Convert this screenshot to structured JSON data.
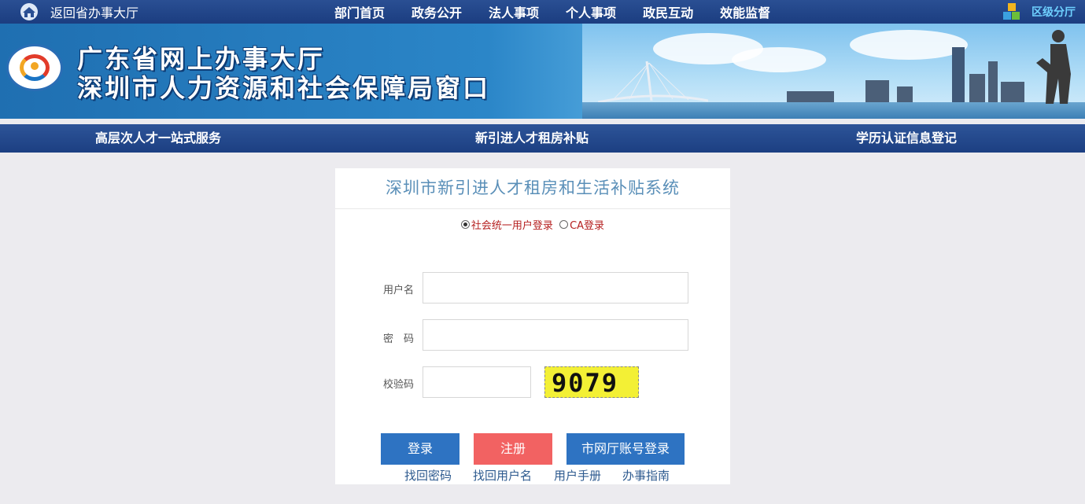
{
  "topbar": {
    "back_label": "返回省办事大厅",
    "nav": [
      "部门首页",
      "政务公开",
      "法人事项",
      "个人事项",
      "政民互动",
      "效能监督"
    ],
    "district_label": "区级分厅"
  },
  "banner": {
    "title_line1": "广东省网上办事大厅",
    "title_line2": "深圳市人力资源和社会保障局窗口"
  },
  "subnav": [
    "高层次人才一站式服务",
    "新引进人才租房补贴",
    "学历认证信息登记"
  ],
  "login": {
    "title": "深圳市新引进人才租房和生活补贴系统",
    "modes": [
      {
        "label": "社会统一用户登录",
        "selected": true
      },
      {
        "label": "CA登录",
        "selected": false
      }
    ],
    "username_label": "用户名",
    "username_value": "",
    "password_label": "密　码",
    "password_value": "",
    "captcha_label": "校验码",
    "captcha_value": "",
    "captcha_image_text": "9079",
    "buttons": {
      "login": "登录",
      "register": "注册",
      "city_account_login": "市网厅账号登录"
    },
    "links": [
      "找回密码",
      "找回用户名",
      "用户手册",
      "办事指南"
    ]
  },
  "colors": {
    "nav_bg": "#1f4386",
    "login_button": "#2e73c2",
    "register_button": "#f26262",
    "title_text": "#5a8fb8",
    "district_text": "#6ed0ff"
  }
}
